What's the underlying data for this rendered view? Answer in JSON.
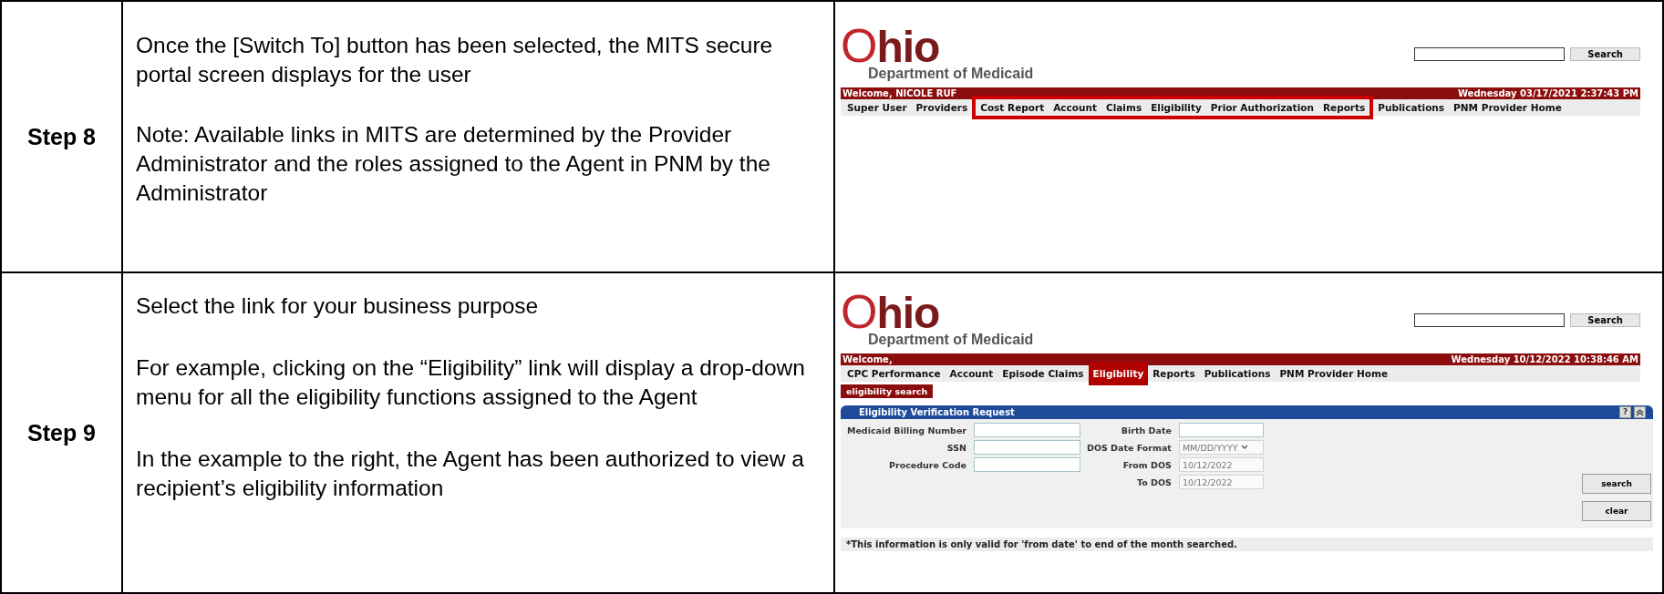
{
  "steps": [
    {
      "label": "Step 8",
      "paragraphs": [
        [
          "Once the [Switch To] button has been selected, the MITS secure portal screen displays for the user"
        ],
        [
          "Note: Available links in MITS are determined by the Provider Administrator and the roles assigned to the Agent in PNM by the Administrator"
        ]
      ],
      "screen": {
        "kind": "home",
        "logo": "Ohio",
        "logo_subtitle": "Department of Medicaid",
        "search_button": "Search",
        "welcome": "Welcome, NICOLE RUF",
        "datetime": "Wednesday 03/17/2021 2:37:43 PM",
        "menu": [
          {
            "label": "Super User",
            "selected": false,
            "highlighted": false
          },
          {
            "label": "Providers",
            "selected": false,
            "highlighted": false
          },
          {
            "label": "Cost Report",
            "selected": false,
            "highlighted": true
          },
          {
            "label": "Account",
            "selected": false,
            "highlighted": true
          },
          {
            "label": "Claims",
            "selected": false,
            "highlighted": true
          },
          {
            "label": "Eligibility",
            "selected": false,
            "highlighted": true
          },
          {
            "label": "Prior Authorization",
            "selected": false,
            "highlighted": true
          },
          {
            "label": "Reports",
            "selected": false,
            "highlighted": true
          },
          {
            "label": "Publications",
            "selected": false,
            "highlighted": false
          },
          {
            "label": "PNM Provider Home",
            "selected": false,
            "highlighted": false
          }
        ]
      }
    },
    {
      "label": "Step 9",
      "paragraphs": [
        [
          "Select the link for your business purpose"
        ],
        [
          "For example, clicking on the “Eligibility” link will display a drop-down menu for all the eligibility functions assigned to the Agent"
        ],
        [
          "In the example to the right, the Agent has been authorized to view a recipient’s eligibility information"
        ]
      ],
      "screen": {
        "kind": "eligibility",
        "logo": "Ohio",
        "logo_subtitle": "Department of Medicaid",
        "search_button": "Search",
        "welcome": "Welcome,",
        "datetime": "Wednesday 10/12/2022 10:38:46 AM",
        "menu": [
          {
            "label": "CPC Performance",
            "selected": false,
            "highlighted": false
          },
          {
            "label": "Account",
            "selected": false,
            "highlighted": false
          },
          {
            "label": "Episode Claims",
            "selected": false,
            "highlighted": false
          },
          {
            "label": "Eligibility",
            "selected": true,
            "highlighted": false
          },
          {
            "label": "Reports",
            "selected": false,
            "highlighted": false
          },
          {
            "label": "Publications",
            "selected": false,
            "highlighted": false
          },
          {
            "label": "PNM Provider Home",
            "selected": false,
            "highlighted": false
          }
        ],
        "submenu": [
          "eligibility search"
        ],
        "panel": {
          "title": "Eligibility Verification Request",
          "help": "?",
          "left_fields": [
            {
              "label": "Medicaid Billing Number",
              "kind": "text"
            },
            {
              "label": "SSN",
              "kind": "text"
            },
            {
              "label": "Procedure Code",
              "kind": "text"
            }
          ],
          "right_fields": [
            {
              "label": "Birth Date",
              "kind": "text"
            },
            {
              "label": "DOS Date Format",
              "kind": "select",
              "value": "MM/DD/YYYY"
            },
            {
              "label": "From DOS",
              "kind": "date",
              "value": "10/12/2022"
            },
            {
              "label": "To DOS",
              "kind": "date",
              "value": "10/12/2022"
            }
          ],
          "buttons": [
            "search",
            "clear"
          ],
          "note": "*This information is only valid for 'from date' to end of the month searched."
        }
      }
    }
  ]
}
